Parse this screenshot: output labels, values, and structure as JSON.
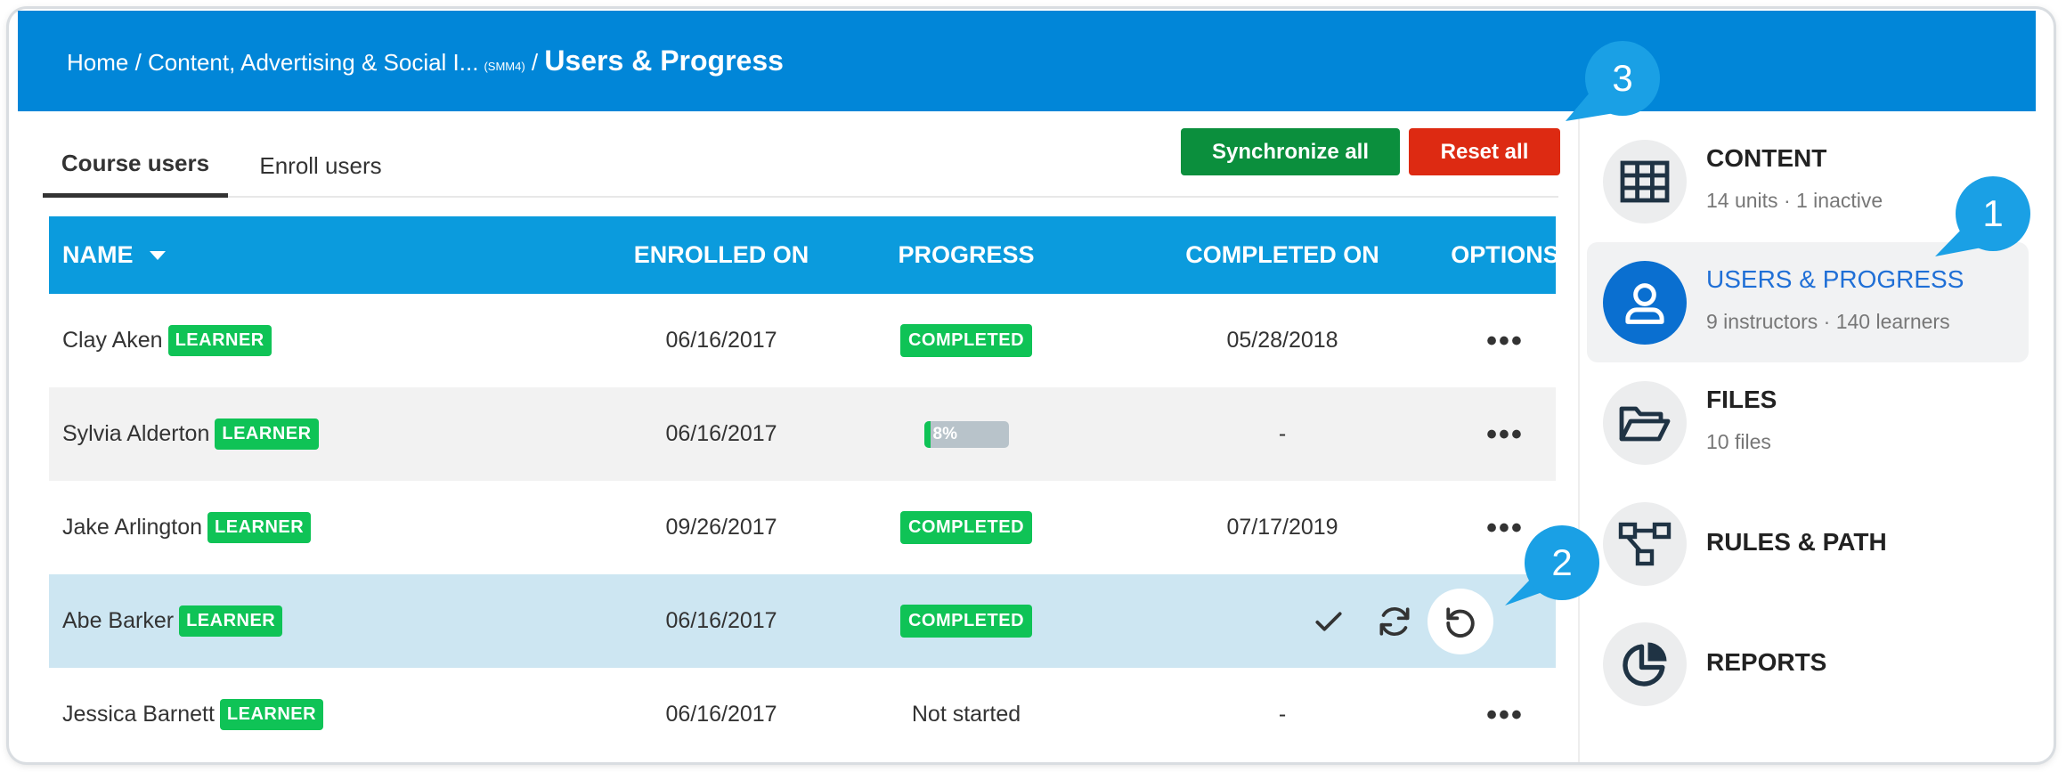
{
  "breadcrumb": {
    "home": "Home",
    "sep": " / ",
    "course": "Content, Advertising & Social I...",
    "course_code": "(SMM4)",
    "current": "Users & Progress"
  },
  "tabs": [
    {
      "label": "Course users",
      "active": true
    },
    {
      "label": "Enroll users",
      "active": false
    }
  ],
  "actions": {
    "sync_label": "Synchronize all",
    "reset_label": "Reset all"
  },
  "table": {
    "headers": [
      "NAME",
      "ENROLLED ON",
      "PROGRESS",
      "COMPLETED ON",
      "OPTIONS"
    ],
    "rows": [
      {
        "name": "Clay Aken",
        "role": "LEARNER",
        "enrolled": "06/16/2017",
        "progress": "COMPLETED",
        "completed": "05/28/2018"
      },
      {
        "name": "Sylvia Alderton",
        "role": "LEARNER",
        "enrolled": "06/16/2017",
        "progress": "8%",
        "progress_value": 0.08,
        "completed": "-"
      },
      {
        "name": "Jake Arlington",
        "role": "LEARNER",
        "enrolled": "09/26/2017",
        "progress": "COMPLETED",
        "completed": "07/17/2019"
      },
      {
        "name": "Abe Barker",
        "role": "LEARNER",
        "enrolled": "06/16/2017",
        "progress": "COMPLETED",
        "completed": ""
      },
      {
        "name": "Jessica Barnett",
        "role": "LEARNER",
        "enrolled": "06/16/2017",
        "progress": "Not started",
        "completed": "-"
      }
    ],
    "options_label": "•••"
  },
  "sidebar": {
    "items": [
      {
        "title": "CONTENT",
        "subtitle": "14 units · 1 inactive",
        "icon": "grid-icon"
      },
      {
        "title": "USERS & PROGRESS",
        "subtitle": "9 instructors · 140 learners",
        "icon": "user-icon",
        "active": true
      },
      {
        "title": "FILES",
        "subtitle": "10 files",
        "icon": "folder-open-icon"
      },
      {
        "title": "RULES & PATH",
        "subtitle": "",
        "icon": "flow-icon"
      },
      {
        "title": "REPORTS",
        "subtitle": "",
        "icon": "pie-chart-icon"
      }
    ]
  },
  "callouts": [
    "1",
    "2",
    "3"
  ],
  "colors": {
    "header_blue": "#0186d8",
    "table_head_blue": "#0b9bdd",
    "learner_green": "#0fc356",
    "sync_green": "#0b8f3d",
    "reset_red": "#dd2a12",
    "callout_blue": "#1aa0e5"
  }
}
